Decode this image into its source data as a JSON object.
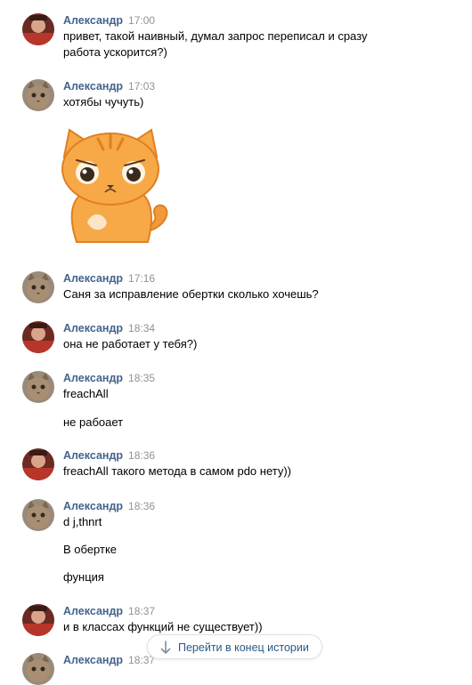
{
  "messages": [
    {
      "author": "Александр",
      "time": "17:00",
      "avatar": "user-photo-avatar",
      "lines": [
        "привет, такой наивный, думал запрос переписал и сразу",
        "работа ускорится?)"
      ]
    },
    {
      "author": "Александр",
      "time": "17:03",
      "avatar": "cat-avatar",
      "lines": [
        "хотябы чучуть)"
      ],
      "sticker": "sad-orange-cat-sticker"
    },
    {
      "author": "Александр",
      "time": "17:16",
      "avatar": "cat-avatar",
      "lines": [
        "Саня за исправление обертки сколько хочешь?"
      ]
    },
    {
      "author": "Александр",
      "time": "18:34",
      "avatar": "user-photo-avatar",
      "lines": [
        "она не работает у тебя?)"
      ]
    },
    {
      "author": "Александр",
      "time": "18:35",
      "avatar": "cat-avatar",
      "lines": [
        "freachAll",
        "не рабоает"
      ]
    },
    {
      "author": "Александр",
      "time": "18:36",
      "avatar": "user-photo-avatar",
      "lines": [
        "freachAll такого метода в самом pdo нету))"
      ]
    },
    {
      "author": "Александр",
      "time": "18:36",
      "avatar": "cat-avatar",
      "lines": [
        "d j,thnrt",
        "В обертке",
        "фунция"
      ]
    },
    {
      "author": "Александр",
      "time": "18:37",
      "avatar": "user-photo-avatar",
      "lines": [
        "и в классах функций не существует))"
      ]
    },
    {
      "author": "Александр",
      "time": "18:37",
      "avatar": "cat-avatar",
      "lines": []
    }
  ],
  "scroll_to_end": {
    "label": "Перейти в конец истории",
    "icon": "arrow-down-icon"
  },
  "colors": {
    "author": "#42648b",
    "time": "#939393",
    "text": "#000000",
    "button_text": "#2a5885",
    "sticker_orange": "#f29a3a"
  }
}
